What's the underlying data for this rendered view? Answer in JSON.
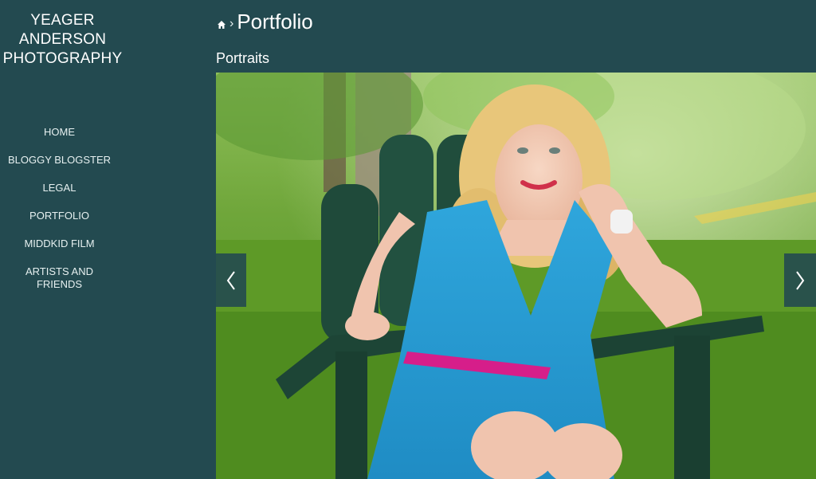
{
  "site": {
    "title_lines": [
      "YEAGER",
      "ANDERSON",
      "PHOTOGRAPHY"
    ]
  },
  "nav": {
    "items": [
      {
        "label": "HOME"
      },
      {
        "label": "BLOGGY BLOGSTER"
      },
      {
        "label": "LEGAL"
      },
      {
        "label": "PORTFOLIO"
      },
      {
        "label": "MIDDKID FILM"
      },
      {
        "label": "ARTISTS AND FRIENDS",
        "line1": "ARTISTS AND",
        "line2": "FRIENDS"
      }
    ]
  },
  "breadcrumb": {
    "home_icon": "home-icon",
    "separator": "›",
    "current": "Portfolio"
  },
  "gallery": {
    "title": "Portraits"
  },
  "viewer": {
    "prev_icon": "chevron-left-icon",
    "next_icon": "chevron-right-icon"
  },
  "colors": {
    "background": "#234a50",
    "text": "#ffffff",
    "arrow_bg": "#234a50"
  }
}
